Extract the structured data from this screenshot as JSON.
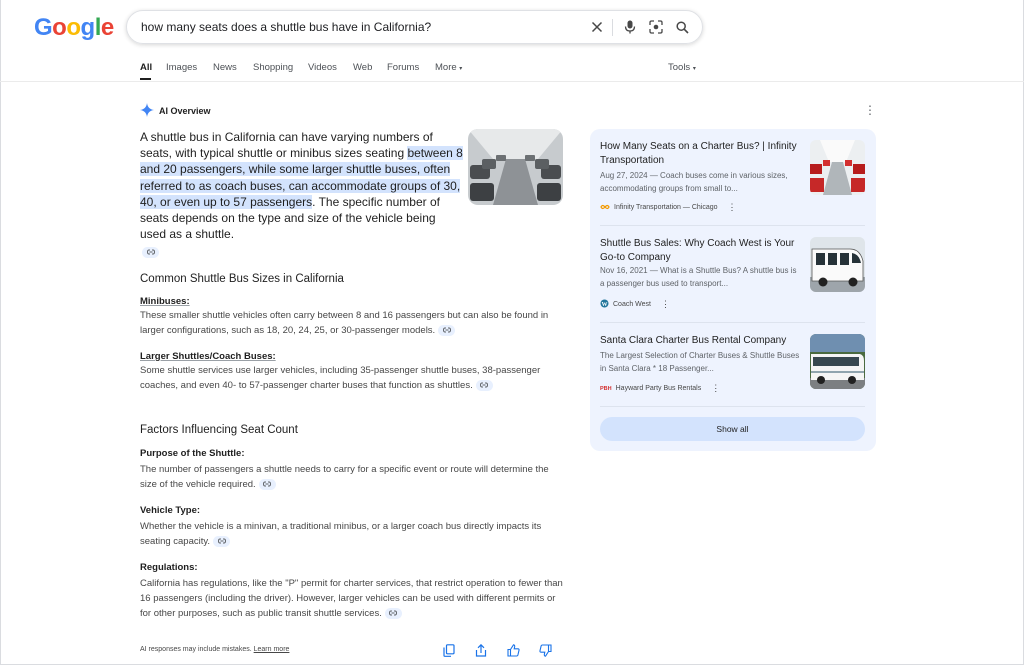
{
  "logo": {
    "letters": [
      "G",
      "o",
      "o",
      "g",
      "l",
      "e"
    ]
  },
  "search": {
    "query": "how many seats does a shuttle bus have in California?"
  },
  "tabs": [
    {
      "label": "All",
      "active": true
    },
    {
      "label": "Images"
    },
    {
      "label": "News"
    },
    {
      "label": "Shopping"
    },
    {
      "label": "Videos"
    },
    {
      "label": "Web"
    },
    {
      "label": "Forums"
    },
    {
      "label": "More"
    }
  ],
  "tools_label": "Tools",
  "ai": {
    "title": "AI Overview",
    "intro_pre": "A shuttle bus in California can have varying numbers of seats, with typical shuttle or minibus sizes seating ",
    "intro_hl": "between 8 and 20 passengers, while some larger shuttle buses, often referred to as coach buses, can accommodate groups of 30, 40, or even up to 57 passengers",
    "intro_post": ". The specific number of seats depends on the type and size of the vehicle being used as a shuttle.",
    "section1_title": "Common Shuttle Bus Sizes in California",
    "minibuses_title": "Minibuses:",
    "minibuses_text": "These smaller shuttle vehicles often carry between 8 and 16 passengers but can also be found in larger configurations, such as 18, 20, 24, 25, or 30-passenger models.",
    "larger_title": "Larger Shuttles/Coach Buses:",
    "larger_text": "Some shuttle services use larger vehicles, including 35-passenger shuttle buses, 38-passenger coaches, and even 40- to 57-passenger charter buses that function as shuttles.",
    "section2_title": "Factors Influencing Seat Count",
    "purpose_title": "Purpose of the Shuttle:",
    "purpose_text": "The number of passengers a shuttle needs to carry for a specific event or route will determine the size of the vehicle required.",
    "vehicle_title": "Vehicle Type:",
    "vehicle_text": "Whether the vehicle is a minivan, a traditional minibus, or a larger coach bus directly impacts its seating capacity.",
    "reg_title": "Regulations:",
    "reg_text": "California has regulations, like the \"P\" permit for charter services, that restrict operation to fewer than 16 passengers (including the driver). However, larger vehicles can be used with different permits or for other purposes, such as public transit shuttle services.",
    "disclaimer": "AI responses may include mistakes.",
    "learn_more": "Learn more"
  },
  "sources": [
    {
      "title": "How Many Seats on a Charter Bus? | Infinity Transportation",
      "snippet": "Aug 27, 2024 — Coach buses come in various sizes, accommodating groups from small to...",
      "site": "Infinity Transportation — Chicago"
    },
    {
      "title": "Shuttle Bus Sales: Why Coach West is Your Go-to Company",
      "snippet": "Nov 16, 2021 — What is a Shuttle Bus? A shuttle bus is a passenger bus used to transport...",
      "site": "Coach West"
    },
    {
      "title": "Santa Clara Charter Bus Rental Company",
      "snippet": "The Largest Selection of Charter Buses & Shuttle Buses in Santa Clara * 18 Passenger...",
      "site": "Hayward Party Bus Rentals"
    }
  ],
  "show_all": "Show all",
  "colors": {
    "highlight": "#d3e3fd",
    "panel": "#eef3fe",
    "accent": "#1a73e8"
  }
}
